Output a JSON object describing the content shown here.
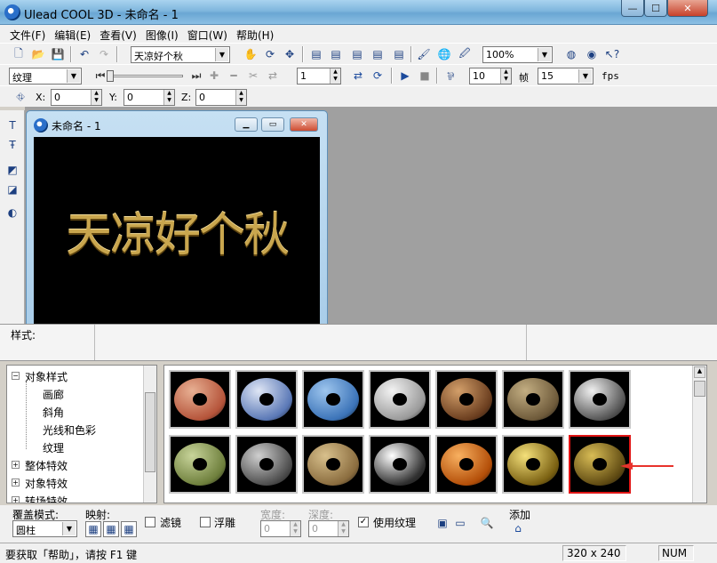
{
  "window": {
    "title": "Ulead COOL 3D - 未命名 - 1",
    "min": "—",
    "max": "☐",
    "close": "✕"
  },
  "menu": [
    "文件(F)",
    "编辑(E)",
    "查看(V)",
    "图像(I)",
    "窗口(W)",
    "帮助(H)"
  ],
  "toolbar1": {
    "text_object": "天凉好个秋",
    "zoom": "100%"
  },
  "toolbar2": {
    "attribute": "纹理",
    "frame": "1",
    "frame_step": "10",
    "frames_label": "帧",
    "fps_value": "15",
    "fps_label": "fps"
  },
  "toolbar3": {
    "x_label": "X:",
    "x_value": "0",
    "y_label": "Y:",
    "y_value": "0",
    "z_label": "Z:",
    "z_value": "0"
  },
  "document": {
    "title": "未命名 - 1",
    "canvas_text": "天凉好个秋"
  },
  "style_panel": {
    "label": "样式:"
  },
  "tree": {
    "root": "对象样式",
    "children": [
      "画廊",
      "斜角",
      "光线和色彩",
      "纹理"
    ],
    "others": [
      "整体特效",
      "对象特效",
      "转场特效"
    ]
  },
  "thumbnails": [
    {
      "name": "brick",
      "colors": [
        "#b5543a",
        "#e8b093"
      ]
    },
    {
      "name": "blue-circuit",
      "colors": [
        "#5a78b6",
        "#dfe6f5"
      ]
    },
    {
      "name": "blue-drops",
      "colors": [
        "#3b73b8",
        "#9ec6ee"
      ]
    },
    {
      "name": "white-brick",
      "colors": [
        "#9a9a9a",
        "#f3f3f3"
      ]
    },
    {
      "name": "wood-bark",
      "colors": [
        "#6b3e1f",
        "#d39f6a"
      ]
    },
    {
      "name": "stone",
      "colors": [
        "#6e5a3a",
        "#c3ae82"
      ]
    },
    {
      "name": "marble",
      "colors": [
        "#555",
        "#f0f0f0"
      ]
    },
    {
      "name": "green-stone",
      "colors": [
        "#6e7f3c",
        "#c8d49a"
      ]
    },
    {
      "name": "granite",
      "colors": [
        "#4d4d4d",
        "#cfcfcf"
      ]
    },
    {
      "name": "sand",
      "colors": [
        "#8a6c3e",
        "#d8c08c"
      ]
    },
    {
      "name": "silver",
      "colors": [
        "#303030",
        "#ffffff"
      ]
    },
    {
      "name": "copper",
      "colors": [
        "#b34e08",
        "#f8b060"
      ]
    },
    {
      "name": "gold",
      "colors": [
        "#7a6011",
        "#f4e07a"
      ]
    },
    {
      "name": "bronze-gold",
      "colors": [
        "#5f4a12",
        "#d8bc55"
      ]
    }
  ],
  "selected_thumbnail": 13,
  "bottom": {
    "cover_mode_label": "覆盖模式:",
    "cover_mode_value": "圆柱",
    "mapping_label": "映射:",
    "filter_label": "滤镜",
    "emboss_label": "浮雕",
    "width_label": "宽度:",
    "width_value": "0",
    "depth_label": "深度:",
    "depth_value": "0",
    "use_texture_label": "使用纹理",
    "use_texture_checked": true,
    "add_label": "添加"
  },
  "status": {
    "help": "要获取「帮助」，请按 F1 键",
    "size": "320 x 240",
    "num": "NUM"
  },
  "accent": {
    "selection_red": "#e01515",
    "gold_text": "#c9a64e"
  }
}
